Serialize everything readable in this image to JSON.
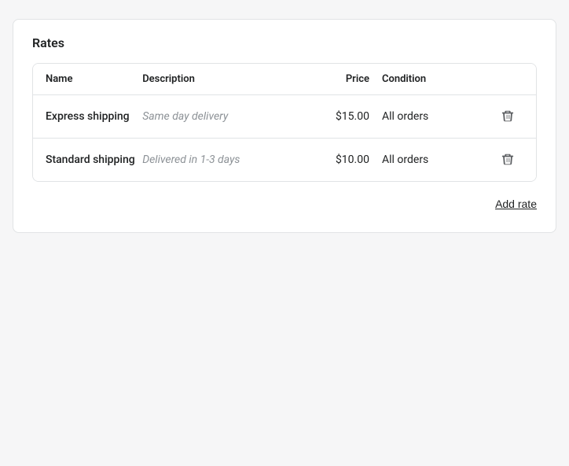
{
  "page": {
    "title": "Rates"
  },
  "table": {
    "headers": {
      "name": "Name",
      "description": "Description",
      "price": "Price",
      "condition": "Condition"
    },
    "rows": [
      {
        "name": "Express shipping",
        "description": "Same day delivery",
        "price": "$15.00",
        "condition": "All orders"
      },
      {
        "name": "Standard shipping",
        "description": "Delivered in 1-3 days",
        "price": "$10.00",
        "condition": "All orders"
      }
    ]
  },
  "actions": {
    "add_rate": "Add rate",
    "delete_aria": "Delete"
  }
}
